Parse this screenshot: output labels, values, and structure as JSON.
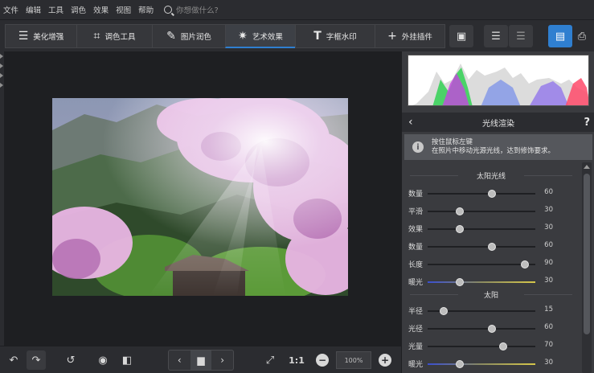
{
  "menu": {
    "items": [
      "文件",
      "编辑",
      "工具",
      "调色",
      "效果",
      "视图",
      "帮助"
    ],
    "search_placeholder": "你想做什么?"
  },
  "toolbar": {
    "tabs": [
      {
        "label": "美化增强",
        "icon": "sliders-icon"
      },
      {
        "label": "调色工具",
        "icon": "crop-icon"
      },
      {
        "label": "图片润色",
        "icon": "brush-icon"
      },
      {
        "label": "艺术效果",
        "icon": "magic-wand-icon",
        "active": true
      },
      {
        "label": "字框水印",
        "icon": "text-icon"
      },
      {
        "label": "外挂插件",
        "icon": "plus-icon"
      }
    ],
    "icons": [
      "image-gallery-icon",
      "batch-add-icon",
      "batch-process-icon",
      "save-icon",
      "print-icon"
    ]
  },
  "bottom": {
    "zoom_value": "100%",
    "ratio_label": "1:1"
  },
  "panel": {
    "title": "光线渲染",
    "tip_line1": "按住鼠标左键",
    "tip_line2": "在照片中移动光源光线，达到修饰要求。",
    "section1": "太阳光线",
    "section2": "太阳",
    "rows1": [
      {
        "label": "数量",
        "value": "60",
        "pos": 0.6
      },
      {
        "label": "平滑",
        "value": "30",
        "pos": 0.3
      },
      {
        "label": "效果",
        "value": "30",
        "pos": 0.3
      },
      {
        "label": "数量",
        "value": "60",
        "pos": 0.6
      },
      {
        "label": "长度",
        "value": "90",
        "pos": 0.9
      },
      {
        "label": "暖光",
        "value": "30",
        "pos": 0.3,
        "gradient": true
      }
    ],
    "rows2": [
      {
        "label": "半径",
        "value": "15",
        "pos": 0.15
      },
      {
        "label": "光径",
        "value": "60",
        "pos": 0.6
      },
      {
        "label": "光量",
        "value": "70",
        "pos": 0.7
      },
      {
        "label": "暖光",
        "value": "30",
        "pos": 0.3,
        "gradient": true
      }
    ]
  },
  "colors": {
    "accent": "#2f7fd0",
    "background": "#2b2c30",
    "panel": "#3a3b3f"
  }
}
